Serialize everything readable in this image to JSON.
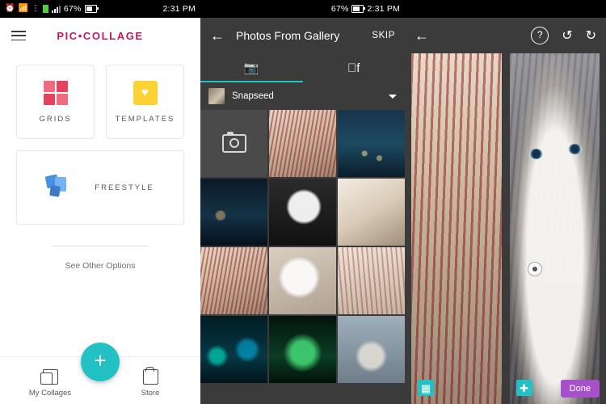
{
  "screens": [
    {
      "id": "home",
      "status_bar": {
        "icons": [
          "alarm-icon",
          "wifi-icon",
          "vpn-icon",
          "sim-icon",
          "signal-icon"
        ],
        "battery_percent": "67%",
        "time": "2:31 PM"
      },
      "appbar": {
        "menu_icon": "hamburger-icon",
        "brand": "PIC•COLLAGE"
      },
      "cards": [
        {
          "label": "GRIDS",
          "icon": "grid-squares-icon"
        },
        {
          "label": "TEMPLATES",
          "icon": "heart-square-icon"
        },
        {
          "label": "FREESTYLE",
          "icon": "scattered-squares-icon"
        }
      ],
      "other_options": "See Other Options",
      "fab": {
        "icon": "plus-icon",
        "color": "#22c1c3"
      },
      "bottom_tabs": [
        {
          "label": "My Collages",
          "icon": "collages-icon"
        },
        {
          "label": "Store",
          "icon": "store-icon"
        }
      ]
    },
    {
      "id": "gallery-picker",
      "status_bar": {
        "battery_percent": "67%",
        "time": "2:31 PM"
      },
      "appbar": {
        "back_icon": "arrow-left-icon",
        "title": "Photos From Gallery",
        "skip_label": "SKIP"
      },
      "tabs": [
        {
          "label": "",
          "icon": "gallery-icon",
          "active": true
        },
        {
          "label": "",
          "icon": "facebook-icon",
          "active": false
        }
      ],
      "album": {
        "name": "Snapseed",
        "caret_icon": "chevron-down-icon",
        "thumb": "album-thumbnail"
      },
      "grid": [
        {
          "name": "camera-tile",
          "kind": "camera"
        },
        {
          "name": "photo-cat-in-straw",
          "kind": "ph-catstraw"
        },
        {
          "name": "photo-city-skyline",
          "kind": "ph-city"
        },
        {
          "name": "photo-night-river",
          "kind": "ph-night"
        },
        {
          "name": "photo-black-cat",
          "kind": "ph-catblack"
        },
        {
          "name": "photo-white-cat",
          "kind": "ph-catwhite"
        },
        {
          "name": "photo-cat-straw-2",
          "kind": "ph-catstraw"
        },
        {
          "name": "photo-cat-face",
          "kind": "ph-catface"
        },
        {
          "name": "photo-cat-paw",
          "kind": "ph-catpaw"
        },
        {
          "name": "photo-supertrees",
          "kind": "ph-trees"
        },
        {
          "name": "photo-green-lights",
          "kind": "ph-greenlight"
        },
        {
          "name": "photo-dog",
          "kind": "ph-dog"
        }
      ]
    },
    {
      "id": "editor",
      "appbar": {
        "back_icon": "arrow-left-icon",
        "help_icon": "question-circle-icon",
        "undo_icon": "undo-icon",
        "redo_icon": "redo-icon"
      },
      "slots": [
        {
          "name": "photo-slot-left",
          "badge_icon": "swap-icon",
          "kind": "straw"
        },
        {
          "name": "photo-slot-right",
          "badge_icon": "swap-icon",
          "kind": "cat"
        }
      ],
      "done_label": "Done",
      "done_color": "#a651c9"
    }
  ]
}
